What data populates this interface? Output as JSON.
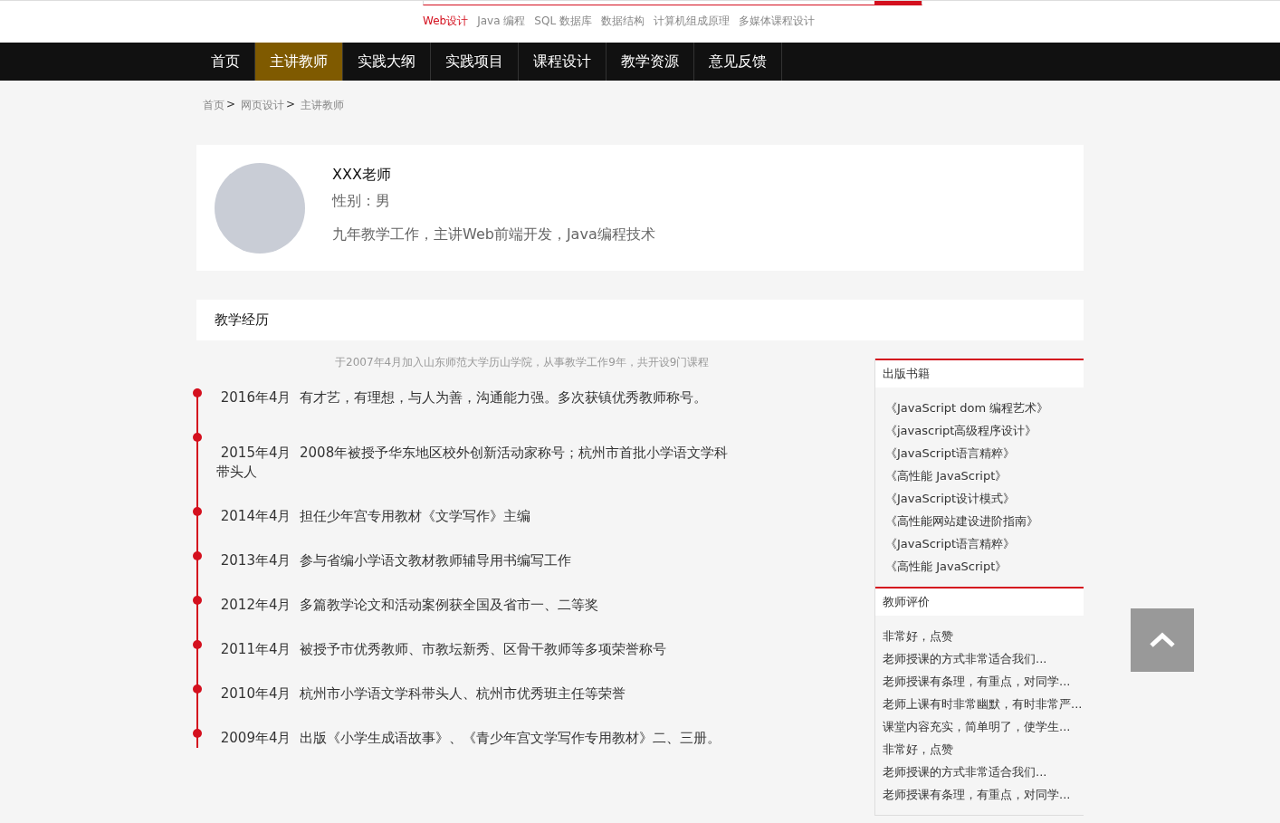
{
  "hot_links": [
    {
      "label": "Web设计",
      "selected": true
    },
    {
      "label": "Java 编程",
      "selected": false
    },
    {
      "label": "SQL 数据库",
      "selected": false
    },
    {
      "label": "数据结构",
      "selected": false
    },
    {
      "label": "计算机组成原理",
      "selected": false
    },
    {
      "label": "多媒体课程设计",
      "selected": false
    }
  ],
  "nav": [
    {
      "label": "首页",
      "selected": false
    },
    {
      "label": "主讲教师",
      "selected": true
    },
    {
      "label": "实践大纲",
      "selected": false
    },
    {
      "label": "实践项目",
      "selected": false
    },
    {
      "label": "课程设计",
      "selected": false
    },
    {
      "label": "教学资源",
      "selected": false
    },
    {
      "label": "意见反馈",
      "selected": false
    }
  ],
  "breadcrumb": [
    {
      "label": "首页",
      "separator": ">"
    },
    {
      "label": "网页设计",
      "separator": ">"
    },
    {
      "label": "主讲教师"
    }
  ],
  "teacher": {
    "name": "XXX老师",
    "gender": "性别：男",
    "intro": "九年教学工作，主讲Web前端开发，Java编程技术"
  },
  "experience": {
    "title": "教学经历",
    "summary": "于2007年4月加入山东师范大学历山学院，从事教学工作9年，共开设9门课程",
    "timeline": [
      {
        "date": "2016年4月",
        "text": "有才艺，有理想，与人为善，沟通能力强。多次获镇优秀教师称号。"
      },
      {
        "date": "2015年4月",
        "text": "2008年被授予华东地区校外创新活动家称号；杭州市首批小学语文学科带头人"
      },
      {
        "date": "2014年4月",
        "text": "担任少年宫专用教材《文学写作》主编"
      },
      {
        "date": "2013年4月",
        "text": "参与省编小学语文教材教师辅导用书编写工作"
      },
      {
        "date": "2012年4月",
        "text": "多篇教学论文和活动案例获全国及省市一、二等奖"
      },
      {
        "date": "2011年4月",
        "text": "被授予市优秀教师、市教坛新秀、区骨干教师等多项荣誉称号"
      },
      {
        "date": "2010年4月",
        "text": "杭州市小学语文学科带头人、杭州市优秀班主任等荣誉"
      },
      {
        "date": "2009年4月",
        "text": "出版《小学生成语故事》、《青少年宫文学写作专用教材》二、三册。"
      }
    ]
  },
  "sidebar": [
    {
      "title": "出版书籍",
      "kind": "books",
      "items": [
        "《JavaScript dom 编程艺术》",
        "《javascript高级程序设计》",
        "《JavaScript语言精粹》",
        "《高性能 JavaScript》",
        "《JavaScript设计模式》",
        "《高性能网站建设进阶指南》",
        "《JavaScript语言精粹》",
        "《高性能 JavaScript》"
      ]
    },
    {
      "title": "教师评价",
      "kind": "reviews",
      "items": [
        "非常好，点赞",
        "老师授课的方式非常适合我们...",
        "老师授课有条理，有重点，对同学...",
        "老师上课有时非常幽默，有时非常严...",
        "课堂内容充实，简单明了，使学生...",
        "非常好，点赞",
        "老师授课的方式非常适合我们...",
        "老师授课有条理，有重点，对同学..."
      ]
    }
  ]
}
